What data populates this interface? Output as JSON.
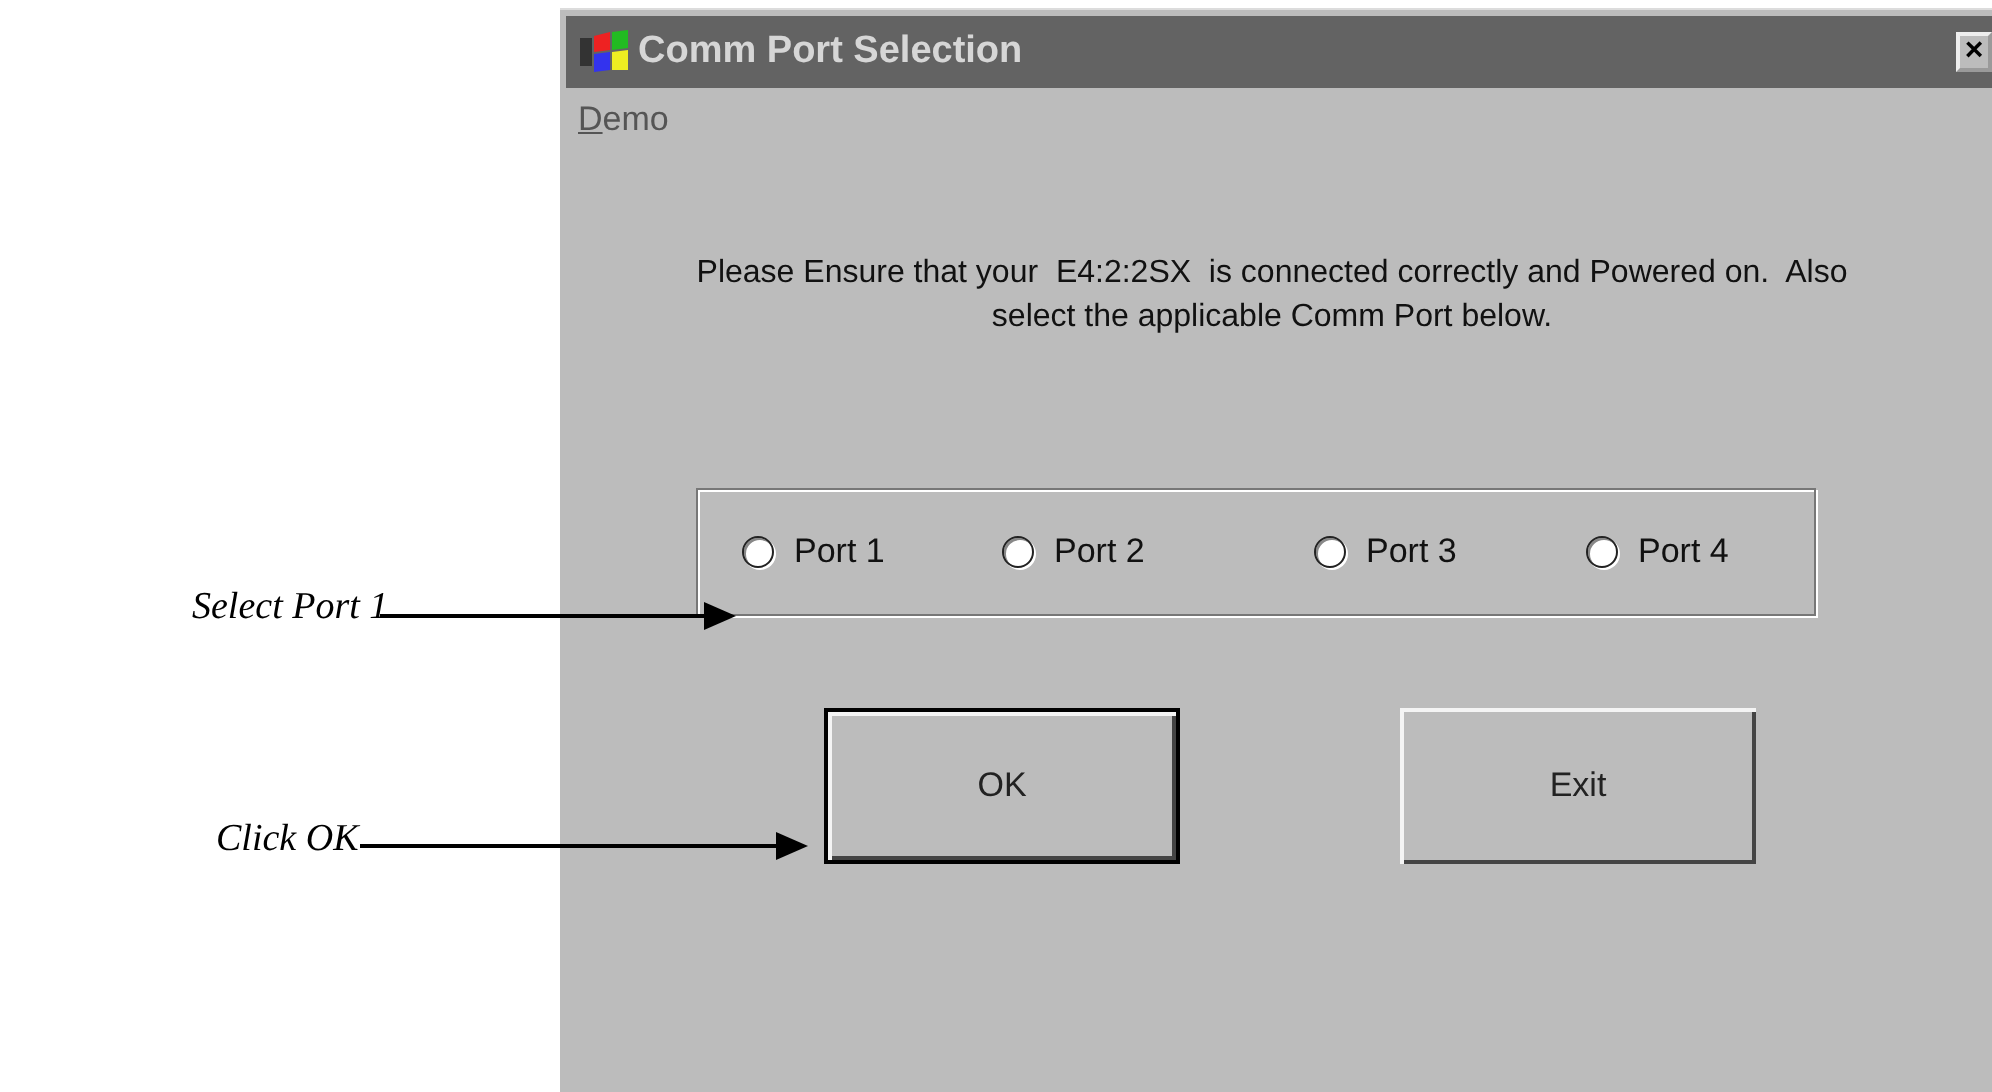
{
  "window": {
    "title": "Comm Port Selection",
    "close_glyph": "×"
  },
  "menu": [
    {
      "label": "Demo"
    }
  ],
  "message": "Please Ensure that your  E4:2:2SX  is connected correctly and Powered on.  Also select the applicable Comm Port below.",
  "ports": [
    {
      "label": "Port 1",
      "selected": false
    },
    {
      "label": "Port 2",
      "selected": false
    },
    {
      "label": "Port 3",
      "selected": false
    },
    {
      "label": "Port 4",
      "selected": false
    }
  ],
  "buttons": [
    {
      "label": "OK",
      "default": true
    },
    {
      "label": "Exit",
      "default": false
    }
  ],
  "annotations": [
    {
      "text": "Select Port 1"
    },
    {
      "text": "Click OK"
    }
  ]
}
